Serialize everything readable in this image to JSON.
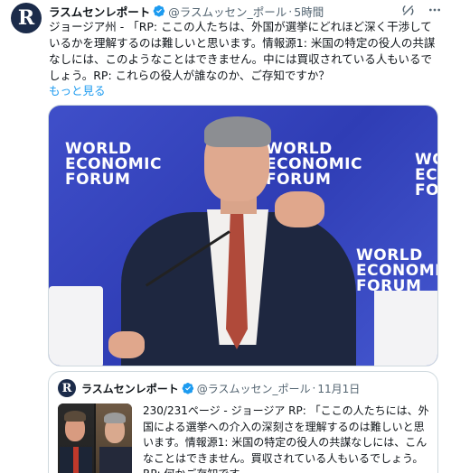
{
  "tweet": {
    "avatar_letter": "R",
    "author_name": "ラスムセンレポート",
    "handle": "@ラスムッセン_ポール",
    "separator": "·",
    "time": "5時間",
    "text": "ジョージア州 - 「RP: ここの人たちは、外国が選挙にどれほど深く干渉しているかを理解するのは難しいと思います。情報源1: 米国の特定の役人の共謀なしには、このようなことはできません。中には買収されている人もいるでしょう。RP: これらの役人が誰なのか、ご存知ですか？",
    "show_more": "もっと見る"
  },
  "media": {
    "banner_words": [
      "WORLD",
      "ECONOMIC",
      "FORUM"
    ]
  },
  "quote": {
    "avatar_letter": "R",
    "author_name": "ラスムセンレポート",
    "handle": "@ラスムッセン_ポール",
    "separator": "·",
    "time": "11月1日",
    "text": "230/231ページ - ジョージア RP: 「ここの人たちには、外国による選挙への介入の深刻さを理解するのは難しいと思います。情報源1: 米国の特定の役人の共謀なしには、こんなことはできません。買収されている人もいるでしょう。RP: 何かご存知です..."
  },
  "colors": {
    "verified": "#1d9bf0",
    "link": "#1d9bf0",
    "wef_blue": "#3a4bc4"
  },
  "icons": {
    "header": [
      "grok-icon",
      "more-icon"
    ]
  }
}
